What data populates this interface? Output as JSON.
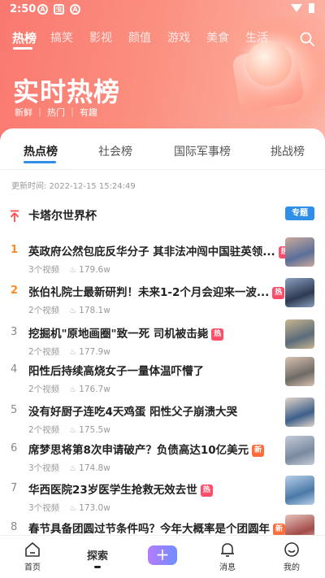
{
  "status": {
    "time": "2:50"
  },
  "top_nav": {
    "tabs": [
      "热榜",
      "搞笑",
      "影视",
      "颜值",
      "游戏",
      "美食",
      "生活"
    ]
  },
  "hero": {
    "title": "实时热榜",
    "subtitle": "新鲜 ｜ 热门 ｜ 有趣"
  },
  "board_tabs": [
    "热点榜",
    "社会榜",
    "国际军事榜",
    "挑战榜"
  ],
  "updated": "更新时间: 2022-12-15 15:24:49",
  "pinned": {
    "title": "卡塔尔世界杯",
    "badge": "专题"
  },
  "items": [
    {
      "rank": "1",
      "title": "英政府公然包庇反华分子 其非法冲闯中国驻英领...",
      "badge": "热",
      "videos": "3个视频",
      "heat": "179.6w"
    },
    {
      "rank": "2",
      "title": "张伯礼院士最新研判！未来1-2个月会迎来一波...",
      "badge": "热",
      "videos": "2个视频",
      "heat": "178.1w"
    },
    {
      "rank": "3",
      "title": "挖掘机\"原地画圈\"致一死 司机被击毙",
      "badge": "热",
      "videos": "2个视频",
      "heat": "177.9w"
    },
    {
      "rank": "4",
      "title": "阳性后持续高烧女子一量体温吓懵了",
      "badge": "",
      "videos": "2个视频",
      "heat": "176.7w"
    },
    {
      "rank": "5",
      "title": "没有好厨子连吃4天鸡蛋 阳性父子崩溃大哭",
      "badge": "",
      "videos": "2个视频",
      "heat": "175.5w"
    },
    {
      "rank": "6",
      "title": "席梦思将第8次申请破产？负债高达10亿美元",
      "badge": "新",
      "videos": "3个视频",
      "heat": "174.8w"
    },
    {
      "rank": "7",
      "title": "华西医院23岁医学生抢救无效去世",
      "badge": "热",
      "videos": "3个视频",
      "heat": "173.0w"
    },
    {
      "rank": "8",
      "title": "春节具备团圆过节条件吗？今年大概率是个团圆年",
      "badge": "新",
      "videos": "",
      "heat": ""
    }
  ],
  "bottom_nav": {
    "home": "首页",
    "explore": "探索",
    "plus": "+",
    "messages": "消息",
    "mine": "我的"
  }
}
